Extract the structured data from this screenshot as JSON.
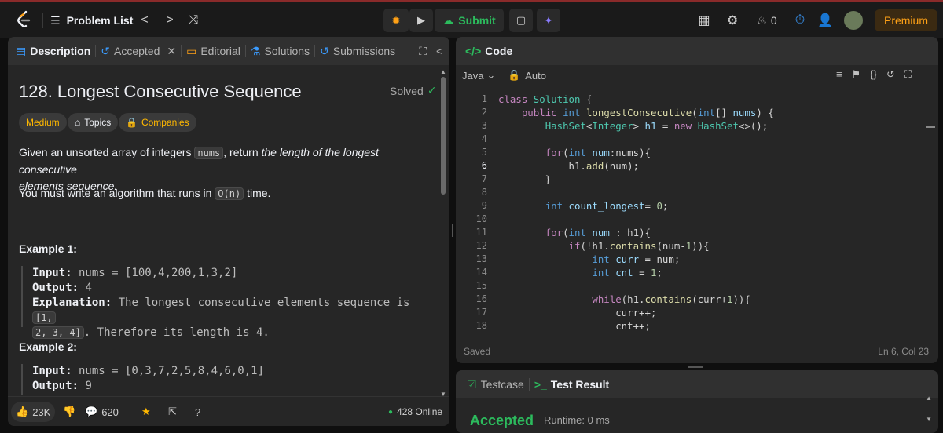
{
  "topbar": {
    "title": "Problem List",
    "submit": "Submit",
    "streak": "0",
    "premium": "Premium"
  },
  "left": {
    "tabs": {
      "description": "Description",
      "accepted": "Accepted",
      "editorial": "Editorial",
      "solutions": "Solutions",
      "submissions": "Submissions"
    },
    "problem": {
      "title": "128. Longest Consecutive Sequence",
      "status": "Solved",
      "difficulty": "Medium",
      "topics": "Topics",
      "companies": "Companies"
    },
    "body": {
      "p1a": "Given an unsorted array of integers ",
      "p1code": "nums",
      "p1b": ", return ",
      "p1em": "the length of the longest consecutive",
      "p1em2": "elements sequence.",
      "p2a": "You must write an algorithm that runs in ",
      "p2code": "O(n)",
      "p2b": " time."
    },
    "examples": [
      {
        "heading": "Example 1:",
        "input_label": "Input:",
        "input": " nums = [100,4,200,1,3,2]",
        "output_label": "Output:",
        "output": " 4",
        "expl_label": "Explanation:",
        "expl": " The longest consecutive elements sequence is ",
        "expl_code": "[1,",
        "expl_code2": "2, 3, 4]",
        "expl_end": ". Therefore its length is 4."
      },
      {
        "heading": "Example 2:",
        "input_label": "Input:",
        "input": " nums = [0,3,7,2,5,8,4,6,0,1]",
        "output_label": "Output:",
        "output": " 9"
      }
    ],
    "footer": {
      "likes": "23K",
      "comments": "620",
      "online": "428 Online"
    }
  },
  "editor": {
    "tab": "Code",
    "language": "Java",
    "mode": "Auto",
    "status": "Saved",
    "cursor": "Ln 6, Col 23",
    "lines": [
      "1",
      "2",
      "3",
      "4",
      "5",
      "6",
      "7",
      "8",
      "9",
      "10",
      "11",
      "12",
      "13",
      "14",
      "15",
      "16",
      "17",
      "18"
    ]
  },
  "bottom": {
    "testcase": "Testcase",
    "result": "Test Result",
    "verdict": "Accepted",
    "runtime": "Runtime: 0 ms"
  },
  "colors": {
    "accent": "#ffa116",
    "green": "#2cbb5d",
    "medium": "#ffb800"
  }
}
